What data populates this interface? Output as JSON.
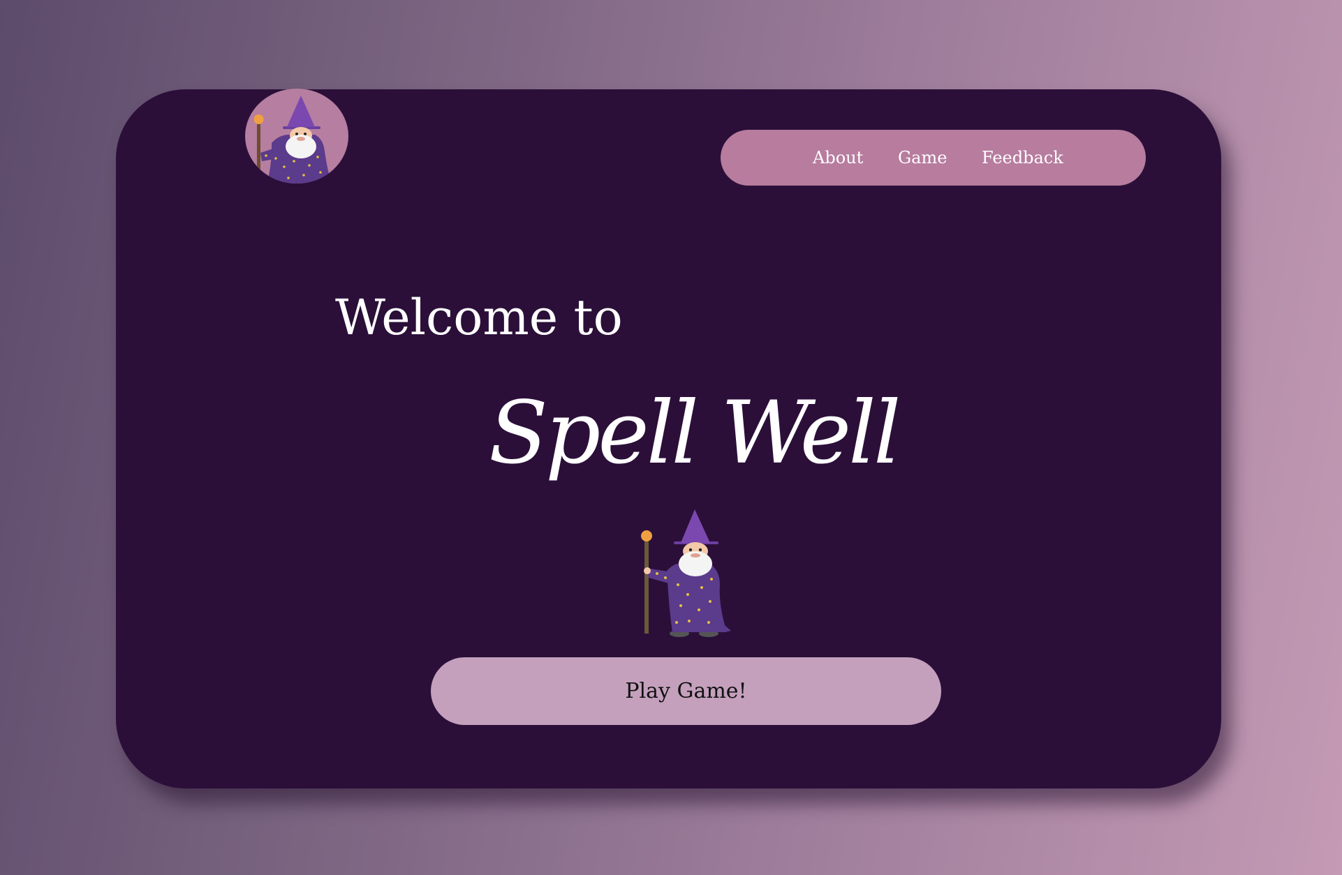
{
  "header": {
    "logo_icon": "wizard-icon",
    "nav": {
      "about": "About",
      "game": "Game",
      "feedback": "Feedback"
    }
  },
  "hero": {
    "welcome_text": "Welcome to",
    "app_title": "Spell Well",
    "illustration_icon": "wizard-icon",
    "play_button_label": "Play Game!"
  },
  "colors": {
    "card_background": "#2b0f39",
    "nav_background": "#b77c9e",
    "button_background": "#c4a0bd",
    "logo_background": "#b67ea0",
    "text": "#ffffff"
  }
}
